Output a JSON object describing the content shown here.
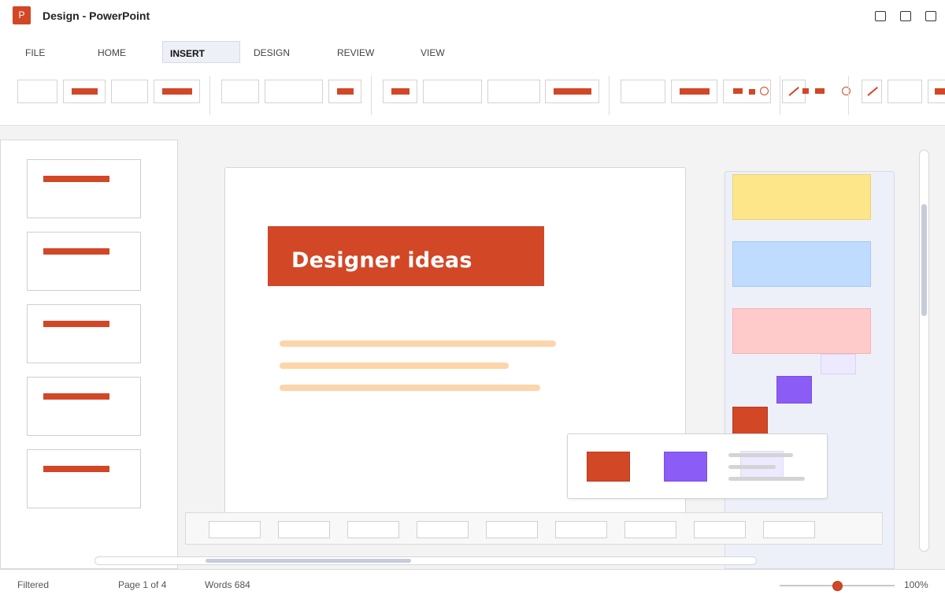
{
  "app": {
    "icon_letter": "P",
    "window_title": "Design - PowerPoint"
  },
  "tabs": [
    {
      "label": "FILE"
    },
    {
      "label": "HOME"
    },
    {
      "label": "INSERT",
      "active": true
    },
    {
      "label": "DESIGN"
    },
    {
      "label": "REVIEW"
    },
    {
      "label": "VIEW"
    }
  ],
  "slide": {
    "title": "Designer ideas"
  },
  "status": {
    "filter": "Filtered",
    "page": "Page 1 of 4",
    "words": "Words 684",
    "zoom": "100%",
    "zoom_fraction": 0.5
  },
  "colors": {
    "accent": "#d24726",
    "ribbon_active": "#eef0f8",
    "swatch_yellow": "#fde68a",
    "swatch_blue": "#bfdbfe",
    "swatch_pink": "#fecaca",
    "swatch_purple": "#8b5cf6",
    "swatch_lavender": "#ede9fe",
    "text_line": "#fcd5ab"
  },
  "icons": {
    "app": "powerpoint-icon",
    "window_buttons": [
      "minimize-icon",
      "maximize-icon",
      "close-icon"
    ]
  }
}
